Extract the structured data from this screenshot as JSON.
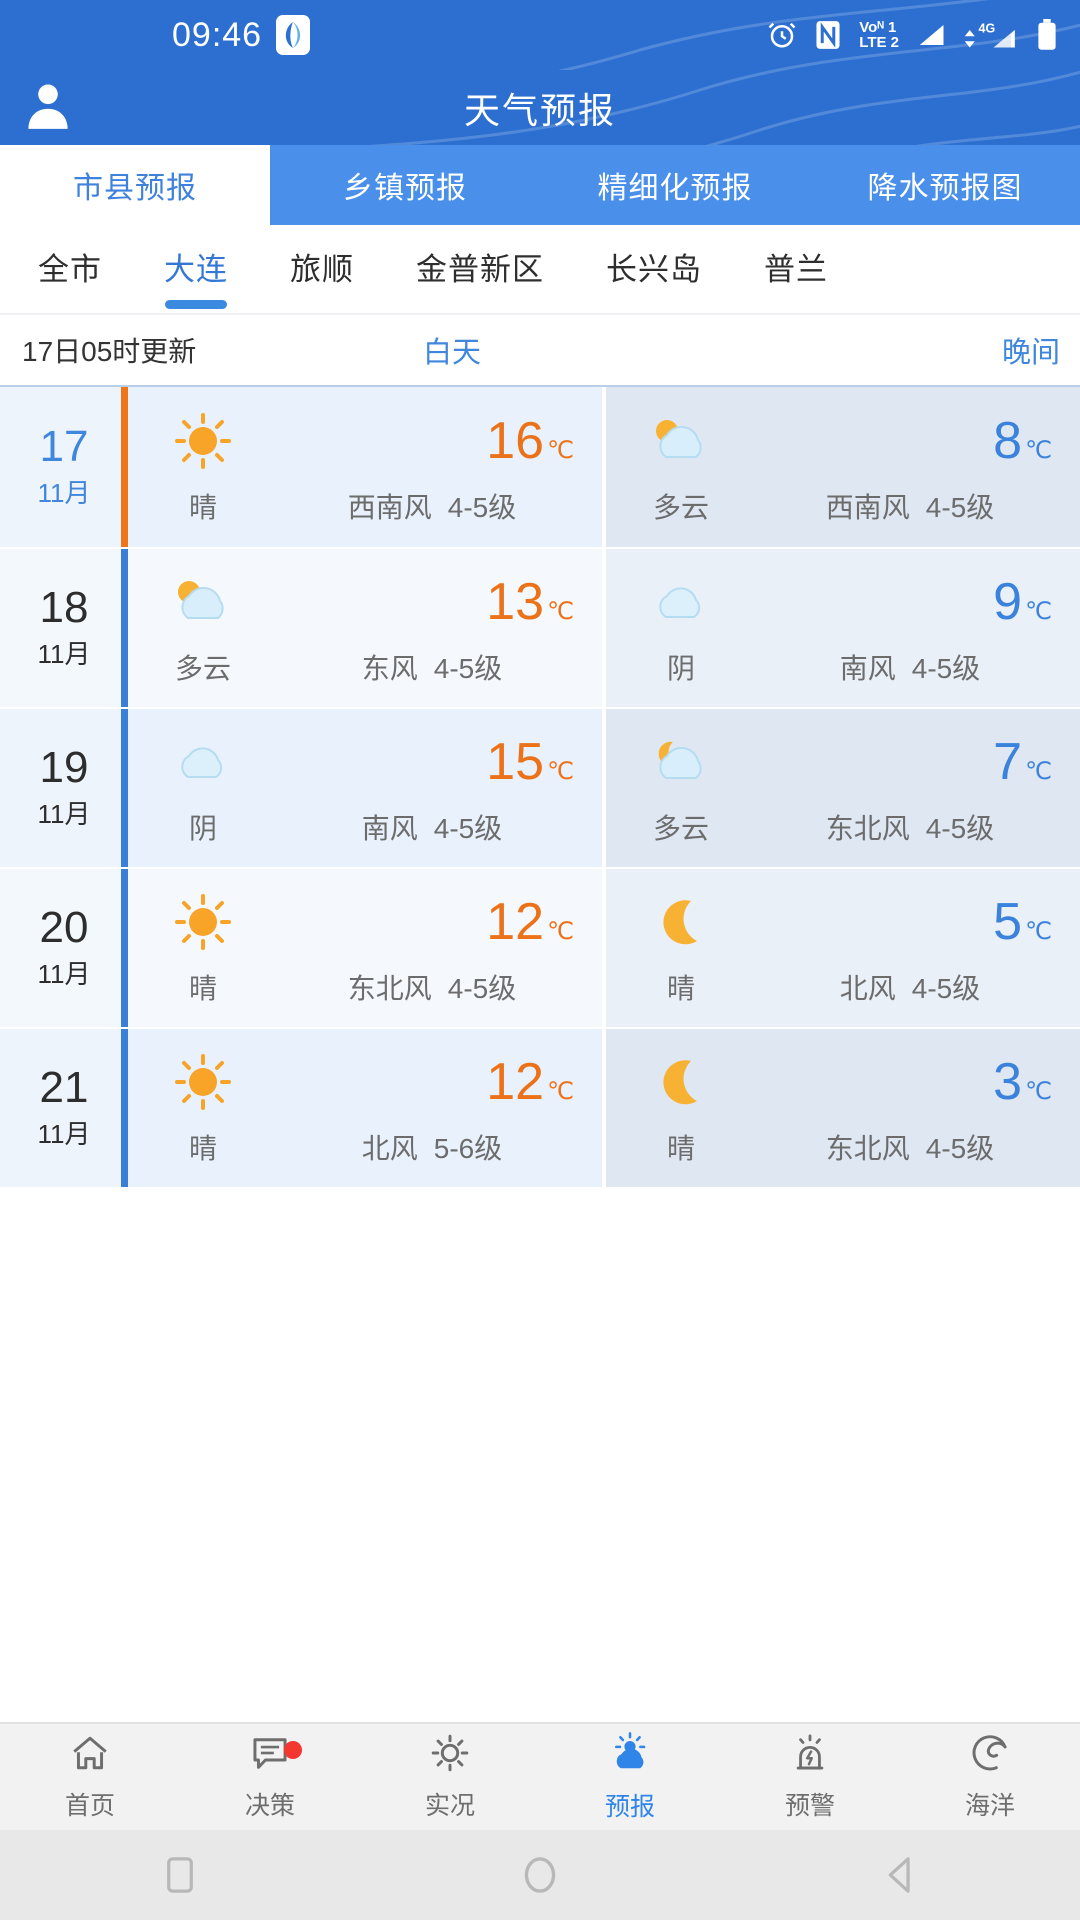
{
  "status_bar": {
    "time": "09:46",
    "app_icon_name": "weather-app-icon",
    "icons": [
      "alarm-icon",
      "nfc-icon",
      "volte-icon",
      "signal-1-icon",
      "mobile-data-4g-icon",
      "battery-icon"
    ],
    "volte_line1": "Voᴺ 1",
    "volte_line2": "LTE 2",
    "network_label": "4G"
  },
  "header": {
    "title": "天气预报",
    "avatar_name": "user-avatar"
  },
  "main_tabs": [
    {
      "label": "市县预报",
      "active": true
    },
    {
      "label": "乡镇预报",
      "active": false
    },
    {
      "label": "精细化预报",
      "active": false
    },
    {
      "label": "降水预报图",
      "active": false
    }
  ],
  "city_tabs": [
    {
      "label": "全市",
      "active": false
    },
    {
      "label": "大连",
      "active": true
    },
    {
      "label": "旅顺",
      "active": false
    },
    {
      "label": "金普新区",
      "active": false
    },
    {
      "label": "长兴岛",
      "active": false
    },
    {
      "label": "普兰",
      "active": false
    }
  ],
  "update_row": {
    "update_text": "17日05时更新",
    "day_label": "白天",
    "night_label": "晚间"
  },
  "forecast": [
    {
      "day_num": "17",
      "month": "11月",
      "today": true,
      "day": {
        "icon": "sun-icon",
        "condition": "晴",
        "wind_dir": "西南风",
        "wind_level": "4-5级",
        "temp": "16",
        "unit": "℃"
      },
      "night": {
        "icon": "sun-cloud-icon",
        "condition": "多云",
        "wind_dir": "西南风",
        "wind_level": "4-5级",
        "temp": "8",
        "unit": "℃"
      }
    },
    {
      "day_num": "18",
      "month": "11月",
      "today": false,
      "day": {
        "icon": "sun-cloud-icon",
        "condition": "多云",
        "wind_dir": "东风",
        "wind_level": "4-5级",
        "temp": "13",
        "unit": "℃"
      },
      "night": {
        "icon": "cloud-icon",
        "condition": "阴",
        "wind_dir": "南风",
        "wind_level": "4-5级",
        "temp": "9",
        "unit": "℃"
      }
    },
    {
      "day_num": "19",
      "month": "11月",
      "today": false,
      "day": {
        "icon": "cloud-icon",
        "condition": "阴",
        "wind_dir": "南风",
        "wind_level": "4-5级",
        "temp": "15",
        "unit": "℃"
      },
      "night": {
        "icon": "moon-cloud-icon",
        "condition": "多云",
        "wind_dir": "东北风",
        "wind_level": "4-5级",
        "temp": "7",
        "unit": "℃"
      }
    },
    {
      "day_num": "20",
      "month": "11月",
      "today": false,
      "day": {
        "icon": "sun-icon",
        "condition": "晴",
        "wind_dir": "东北风",
        "wind_level": "4-5级",
        "temp": "12",
        "unit": "℃"
      },
      "night": {
        "icon": "moon-icon",
        "condition": "晴",
        "wind_dir": "北风",
        "wind_level": "4-5级",
        "temp": "5",
        "unit": "℃"
      }
    },
    {
      "day_num": "21",
      "month": "11月",
      "today": false,
      "day": {
        "icon": "sun-icon",
        "condition": "晴",
        "wind_dir": "北风",
        "wind_level": "5-6级",
        "temp": "12",
        "unit": "℃"
      },
      "night": {
        "icon": "moon-icon",
        "condition": "晴",
        "wind_dir": "东北风",
        "wind_level": "4-5级",
        "temp": "3",
        "unit": "℃"
      }
    }
  ],
  "bottom_nav": [
    {
      "label": "首页",
      "icon": "home-icon",
      "active": false,
      "badge": false
    },
    {
      "label": "决策",
      "icon": "message-icon",
      "active": false,
      "badge": true
    },
    {
      "label": "实况",
      "icon": "sun-icon",
      "active": false,
      "badge": false
    },
    {
      "label": "预报",
      "icon": "sun-cloud-icon",
      "active": true,
      "badge": false
    },
    {
      "label": "预警",
      "icon": "alarm-light-icon",
      "active": false,
      "badge": false
    },
    {
      "label": "海洋",
      "icon": "wave-icon",
      "active": false,
      "badge": false
    }
  ],
  "android_nav": [
    {
      "icon": "recents-square-icon"
    },
    {
      "icon": "home-circle-icon"
    },
    {
      "icon": "back-triangle-icon"
    }
  ],
  "colors": {
    "brand_blue": "#2c6fd1",
    "tab_blue": "#4a90ea",
    "accent_orange": "#ee7518",
    "temp_day": "#ec7219",
    "temp_night": "#3a82dc",
    "badge_red": "#f4382f"
  }
}
